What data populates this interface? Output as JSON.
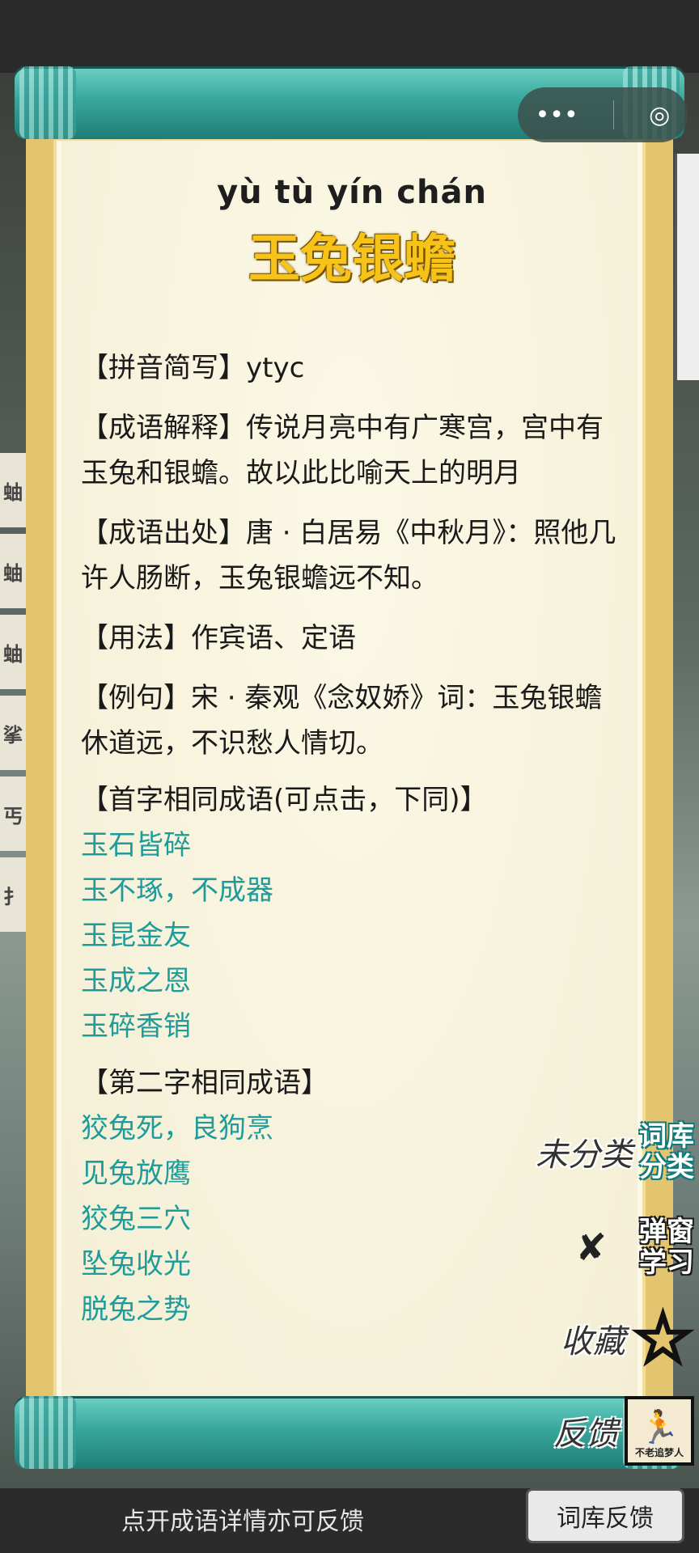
{
  "capsule": {
    "more_icon": "more-dots-icon",
    "close_icon": "target-circle-icon"
  },
  "entry": {
    "pinyin": "yù tù yín chán",
    "title": "玉兔银蟾",
    "fields": [
      {
        "tag": "【拼音简写】",
        "text": "ytyc"
      },
      {
        "tag": "【成语解释】",
        "text": "传说月亮中有广寒宫，宫中有玉兔和银蟾。故以此比喻天上的明月"
      },
      {
        "tag": "【成语出处】",
        "text": "唐 · 白居易《中秋月》：照他几许人肠断，玉兔银蟾远不知。"
      },
      {
        "tag": "【用法】",
        "text": "作宾语、定语"
      },
      {
        "tag": "【例句】",
        "text": "宋 · 秦观《念奴娇》词：玉兔银蟾休道远，不识愁人情切。"
      }
    ]
  },
  "sections": [
    {
      "title": "【首字相同成语(可点击，下同)】",
      "idioms": [
        "玉石皆碎",
        "玉不琢，不成器",
        "玉昆金友",
        "玉成之恩",
        "玉碎香销"
      ]
    },
    {
      "title": "【第二字相同成语】",
      "idioms": [
        "狡兔死，良狗烹",
        "见兔放鹰",
        "狡兔三穴",
        "坠兔收光",
        "脱兔之势"
      ]
    }
  ],
  "side_actions": {
    "category_label": "未分类",
    "category_badge_1": "词库",
    "category_badge_2": "分类",
    "popup_badge_1": "弹窗",
    "popup_badge_2": "学习",
    "favorite_label": "收藏",
    "feedback_label": "反馈",
    "avatar_text": "不老追梦人"
  },
  "left_tabs": [
    "蚰",
    "蚰",
    "蚰",
    "挲",
    "丐",
    "扌"
  ],
  "bottom": {
    "hint": "点开成语详情亦可反馈",
    "button": "词库反馈"
  }
}
